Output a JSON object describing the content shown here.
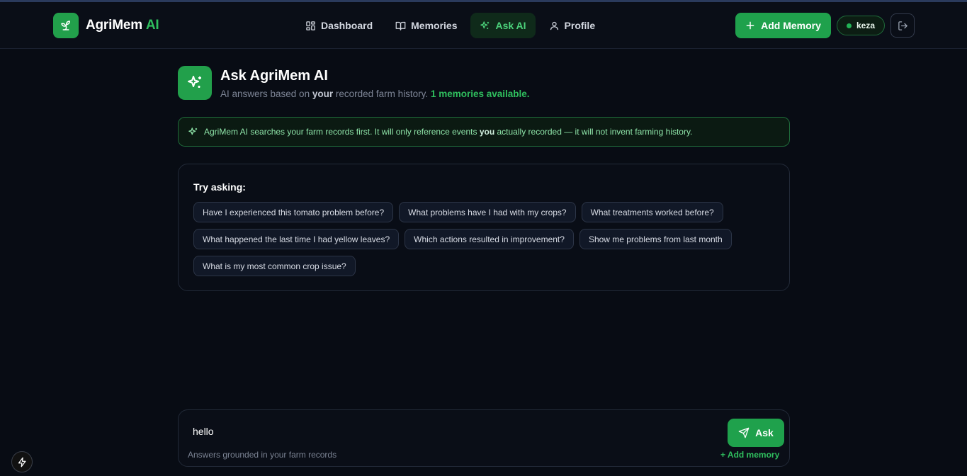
{
  "brand": {
    "name": "AgriMem",
    "suffix": "AI",
    "accent": "#22a04b"
  },
  "nav": [
    {
      "label": "Dashboard",
      "icon": "dashboard-grid-icon",
      "active": false
    },
    {
      "label": "Memories",
      "icon": "book-icon",
      "active": false
    },
    {
      "label": "Ask AI",
      "icon": "sparkles-icon",
      "active": true
    },
    {
      "label": "Profile",
      "icon": "user-icon",
      "active": false
    }
  ],
  "header": {
    "add_memory_label": "Add Memory",
    "username": "keza"
  },
  "page": {
    "title": "Ask AgriMem AI",
    "subtitle_pre": "AI answers based on",
    "subtitle_bold": "your",
    "subtitle_post": "recorded farm history.",
    "memories_count": "1 memories available."
  },
  "notice": {
    "text_pre": "AgriMem AI searches your farm records first. It will only reference events",
    "text_bold": "you",
    "text_post": "actually recorded — it will not invent farming history."
  },
  "suggestions": {
    "title": "Try asking:",
    "items": [
      "Have I experienced this tomato problem before?",
      "What problems have I had with my crops?",
      "What treatments worked before?",
      "What happened the last time I had yellow leaves?",
      "Which actions resulted in improvement?",
      "Show me problems from last month",
      "What is my most common crop issue?"
    ]
  },
  "ask": {
    "value": "hello",
    "button_label": "Ask",
    "hint": "Answers grounded in your farm records",
    "add_memory_link": "+ Add memory"
  }
}
